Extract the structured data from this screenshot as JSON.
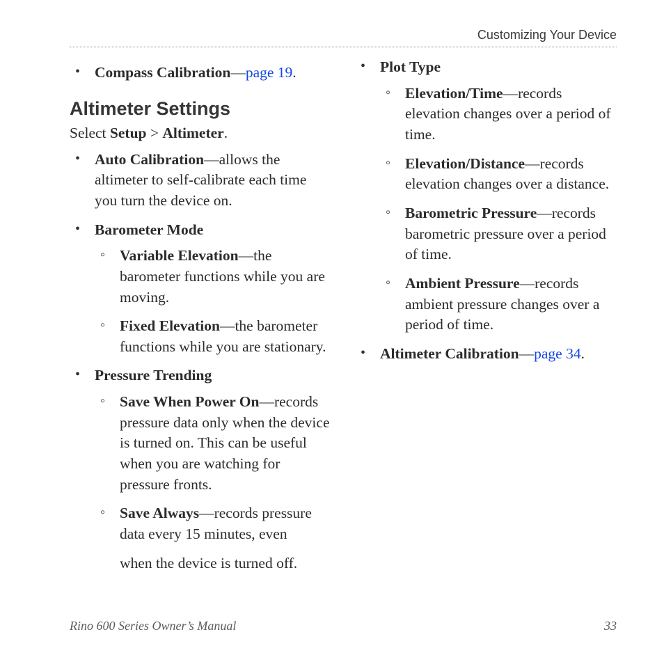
{
  "header": {
    "section": "Customizing Your Device"
  },
  "top_item": {
    "label": "Compass Calibration",
    "link": "page 19",
    "trail": "."
  },
  "section_heading": "Altimeter Settings",
  "select_line": {
    "lead": "Select ",
    "step1": "Setup",
    "sep": " > ",
    "step2": "Altimeter",
    "end": "."
  },
  "items": {
    "auto_cal": {
      "label": "Auto Calibration",
      "desc": "—allows the altimeter to self-calibrate each time you turn the device on."
    },
    "barometer_mode": {
      "label": "Barometer Mode",
      "sub": {
        "variable": {
          "label": "Variable Elevation",
          "desc": "—the barometer functions while you are moving."
        },
        "fixed": {
          "label": "Fixed Elevation",
          "desc": "—the barometer functions while you are stationary."
        }
      }
    },
    "pressure_trending": {
      "label": "Pressure Trending",
      "sub": {
        "save_on": {
          "label": "Save When Power On",
          "dash": "—",
          "desc": "records pressure data only when the device is turned on. This can be useful when you are watching for pressure fronts."
        },
        "save_always": {
          "label": "Save Always",
          "desc_a": "—records pressure data every 15 minutes, even",
          "desc_b": "when the device is turned off."
        }
      }
    },
    "plot_type": {
      "label": "Plot Type",
      "sub": {
        "elev_time": {
          "label": "Elevation/Time",
          "desc": "—records elevation changes over a period of time."
        },
        "elev_dist": {
          "label": "Elevation/Distance",
          "desc": "—records elevation changes over a distance."
        },
        "baro_press": {
          "label": "Barometric Pressure",
          "desc": "—records barometric pressure over a period of time."
        },
        "amb_press": {
          "label": "Ambient Pressure",
          "desc": "—records ambient pressure changes over a period of time."
        }
      }
    },
    "alt_cal": {
      "label": "Altimeter Calibration",
      "dash": "—",
      "link": "page 34",
      "trail": "."
    }
  },
  "footer": {
    "manual": "Rino 600 Series Owner’s Manual",
    "page": "33"
  }
}
